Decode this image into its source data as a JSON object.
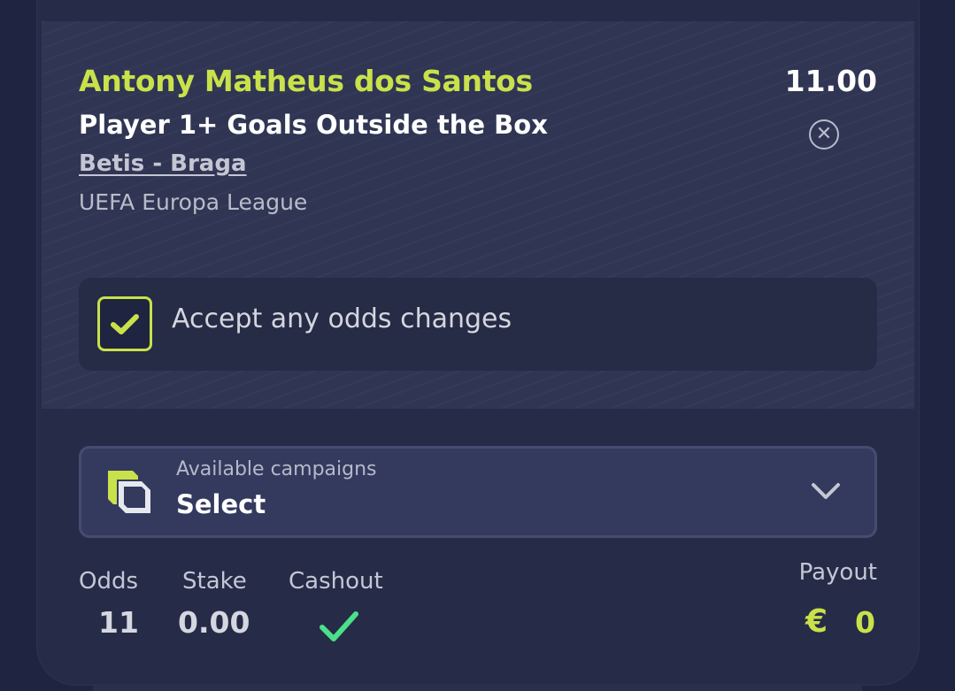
{
  "selection": {
    "player": "Antony Matheus dos Santos",
    "odds": "11.00",
    "market": "Player 1+ Goals Outside the Box",
    "match": "Betis - Braga",
    "league": "UEFA Europa League",
    "remove_icon": "close-circle-icon"
  },
  "accept_changes": {
    "label": "Accept any odds changes",
    "checked": true
  },
  "campaign": {
    "caption": "Available campaigns",
    "value": "Select",
    "icon": "campaign-icon",
    "dropdown_icon": "chevron-down-icon"
  },
  "summary": {
    "odds_label": "Odds",
    "odds_value": "11",
    "stake_label": "Stake",
    "stake_value": "0.00",
    "cashout_label": "Cashout",
    "cashout_enabled": true,
    "payout_label": "Payout",
    "payout_currency": "€",
    "payout_value": "0"
  },
  "colors": {
    "accent": "#c9e14a",
    "background": "#1f2440",
    "card": "#262b48",
    "selection_bg": "#2f3553",
    "cashout_check": "#4be08a"
  }
}
